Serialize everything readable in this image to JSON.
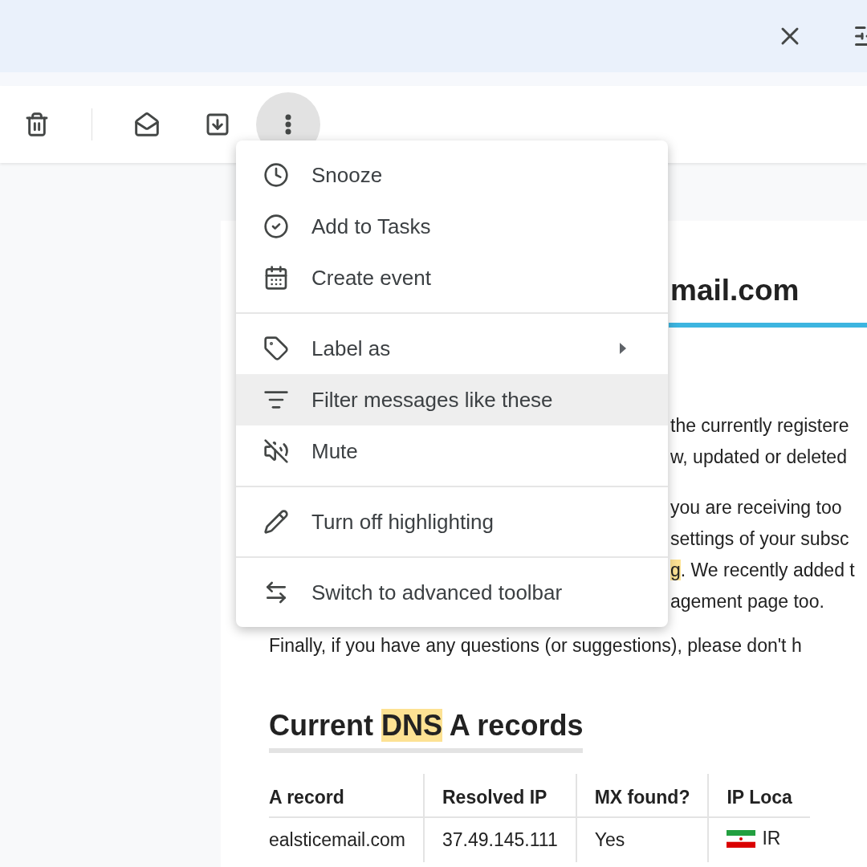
{
  "top_bar": {
    "buttons": [
      {
        "kind": "close"
      },
      {
        "kind": "tune"
      }
    ]
  },
  "toolbar": {
    "more_open": true,
    "buttons": [
      {
        "kind": "delete"
      },
      {
        "kind": "divider"
      },
      {
        "kind": "unread"
      },
      {
        "kind": "inbox"
      },
      {
        "kind": "more"
      }
    ]
  },
  "menu": {
    "groups": [
      {
        "items": [
          {
            "kind": "snooze",
            "label": "Snooze",
            "selected": false
          },
          {
            "kind": "task",
            "label": "Add to Tasks",
            "selected": false
          },
          {
            "kind": "event",
            "label": "Create event",
            "selected": false
          }
        ]
      },
      {
        "items": [
          {
            "kind": "label",
            "label": "Label as",
            "selected": false,
            "submenu": true
          },
          {
            "kind": "filter",
            "label": "Filter messages like these",
            "selected": true
          },
          {
            "kind": "mute",
            "label": "Mute",
            "selected": false
          }
        ]
      },
      {
        "items": [
          {
            "kind": "highlight",
            "label": "Turn off highlighting",
            "selected": false
          }
        ]
      },
      {
        "items": [
          {
            "kind": "swap",
            "label": "Switch to advanced toolbar",
            "selected": false
          }
        ]
      }
    ]
  },
  "email": {
    "title": "mail.com",
    "paragraphs": [
      {
        "lines": [
          [
            {
              "text": "the currently registere",
              "highlight": false
            }
          ],
          [
            {
              "text": "w, updated or deleted",
              "highlight": false
            }
          ]
        ]
      },
      {
        "lines": [
          [
            {
              "text": "you are receiving too",
              "highlight": false
            }
          ],
          [
            {
              "text": "settings of your subsc",
              "highlight": false
            }
          ],
          [
            {
              "text": "g",
              "highlight": true
            },
            {
              "text": ". We recently added t",
              "highlight": false
            }
          ],
          [
            {
              "text": "agement page too.",
              "highlight": false
            }
          ]
        ]
      }
    ],
    "closing": "Finally, if you have any questions (or suggestions), please don't h",
    "section_heading": [
      {
        "text": "Current ",
        "highlight": false
      },
      {
        "text": "DNS",
        "highlight": true
      },
      {
        "text": " A records",
        "highlight": false
      }
    ],
    "table": {
      "columns": [
        "A record",
        "Resolved IP",
        "MX found?",
        "IP Loca"
      ],
      "rows": [
        {
          "cells": [
            "ealsticemail.com",
            "37.49.145.111",
            "Yes",
            "IR"
          ],
          "flag": true
        }
      ]
    }
  }
}
